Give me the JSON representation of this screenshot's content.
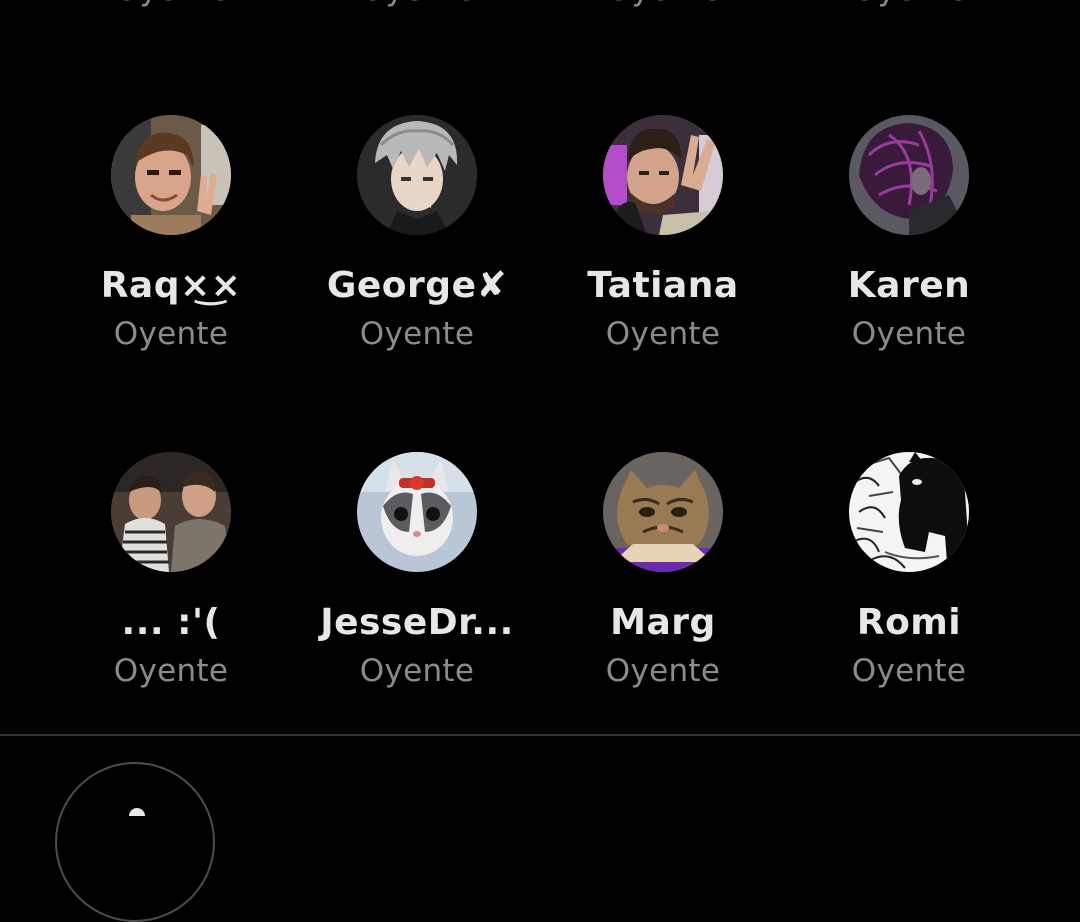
{
  "top_row_roles": [
    "Oyente",
    "Oyente",
    "Oyente",
    "Oyente"
  ],
  "listeners": [
    {
      "name": "Raq×͜×",
      "role": "Oyente",
      "avatar": "man-peace-sign-photo"
    },
    {
      "name": "George✘",
      "role": "Oyente",
      "avatar": "anime-silver-hair-drawing"
    },
    {
      "name": "Tatiana",
      "role": "Oyente",
      "avatar": "man-headphones-peace-photo"
    },
    {
      "name": "Karen",
      "role": "Oyente",
      "avatar": "purple-abstract-portrait"
    },
    {
      "name": "... :'(",
      "role": "Oyente",
      "avatar": "two-men-selfie-photo"
    },
    {
      "name": "JesseDr...",
      "role": "Oyente",
      "avatar": "cat-with-bow-photo"
    },
    {
      "name": "Marg",
      "role": "Oyente",
      "avatar": "tabby-kitten-photo"
    },
    {
      "name": "Romi",
      "role": "Oyente",
      "avatar": "manga-black-white-panel"
    }
  ],
  "colors": {
    "background": "#000000",
    "name": "#e7e7e7",
    "role": "#8b8b8b",
    "divider": "#2f3336"
  }
}
